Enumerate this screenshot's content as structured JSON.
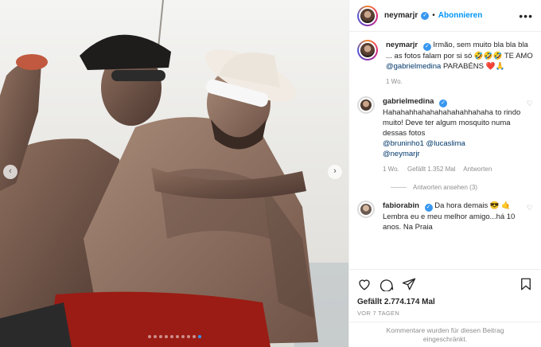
{
  "header": {
    "username": "neymarjr",
    "separator": "•",
    "follow_label": "Abonnieren",
    "more_label": "•••"
  },
  "comments": [
    {
      "username": "neymarjr",
      "text": "Irmão, sem muito bla bla bla ... as fotos falam por si só 🤣🤣🤣 TE AMO ",
      "mention": "@gabrielmedina",
      "tail": " PARABÉNS ❤️🙏",
      "time": "1 Wo."
    },
    {
      "username": "gabrielmedina",
      "text": "Hahahahhahahahahahahhahaha to rindo muito! Deve ter algum mosquito numa dessas fotos ",
      "mentions": [
        "@bruninho1",
        "@lucaslima",
        "@neymarjr"
      ],
      "time": "1 Wo.",
      "likes": "Gefällt 1.352 Mal",
      "reply": "Antworten",
      "view_replies": "Antworten ansehen (3)"
    },
    {
      "username": "fabiorabin",
      "text": "Da hora demais 😎 🤙 Lembra eu e meu melhor amigo...há 10 anos. Na Praia"
    }
  ],
  "actions": {
    "like_icon": "heart-icon",
    "comment_icon": "comment-icon",
    "share_icon": "share-icon",
    "save_icon": "bookmark-icon"
  },
  "likes": "Gefällt 2.774.174 Mal",
  "posted": "VOR 7 TAGEN",
  "comments_closed": "Kommentare wurden für diesen Beitrag eingeschränkt.",
  "carousel": {
    "prev": "‹",
    "next": "›",
    "total": 10,
    "active": 9
  },
  "colors": {
    "accent": "#0095f6",
    "verified": "#3897f0",
    "muted": "#8e8e8e"
  }
}
